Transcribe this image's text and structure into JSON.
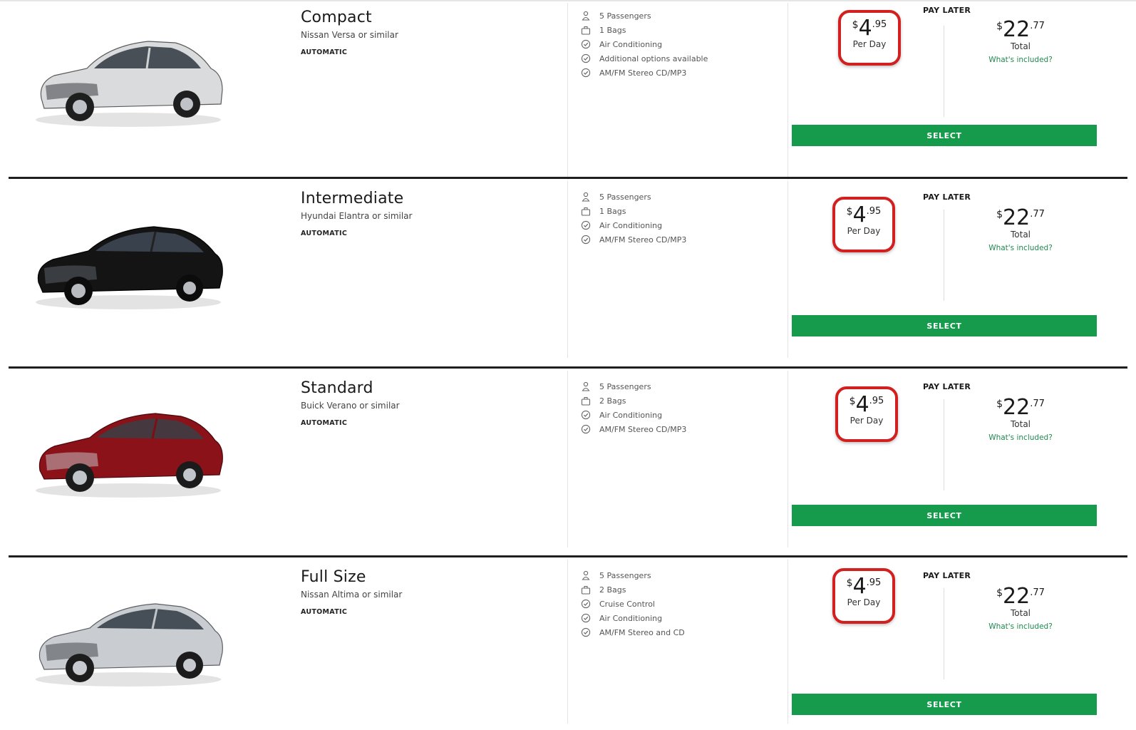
{
  "colors": {
    "accent_green": "#169a4c",
    "highlight_red": "#d21f1f",
    "link_green": "#1d8a4e"
  },
  "cars": [
    {
      "class_name": "Compact",
      "model": "Nissan Versa or similar",
      "transmission": "AUTOMATIC",
      "car_color": "#d9dbdd",
      "features": [
        {
          "icon": "person-icon",
          "label": "5 Passengers"
        },
        {
          "icon": "bag-icon",
          "label": "1 Bags"
        },
        {
          "icon": "check-circle-icon",
          "label": "Air Conditioning"
        },
        {
          "icon": "check-circle-icon",
          "label": "Additional options available"
        },
        {
          "icon": "check-circle-icon",
          "label": "AM/FM Stereo CD/MP3"
        }
      ],
      "per_day": {
        "currency": "$",
        "whole": "4",
        "cents": ".95",
        "label": "Per Day"
      },
      "pay_label": "PAY LATER",
      "total": {
        "currency": "$",
        "whole": "22",
        "cents": ".77",
        "label": "Total",
        "link": "What's included?"
      },
      "select_label": "SELECT"
    },
    {
      "class_name": "Intermediate",
      "model": "Hyundai Elantra or similar",
      "transmission": "AUTOMATIC",
      "car_color": "#141414",
      "features": [
        {
          "icon": "person-icon",
          "label": "5 Passengers"
        },
        {
          "icon": "bag-icon",
          "label": "1 Bags"
        },
        {
          "icon": "check-circle-icon",
          "label": "Air Conditioning"
        },
        {
          "icon": "check-circle-icon",
          "label": "AM/FM Stereo CD/MP3"
        }
      ],
      "per_day": {
        "currency": "$",
        "whole": "4",
        "cents": ".95",
        "label": "Per Day"
      },
      "pay_label": "PAY LATER",
      "total": {
        "currency": "$",
        "whole": "22",
        "cents": ".77",
        "label": "Total",
        "link": "What's included?"
      },
      "select_label": "SELECT"
    },
    {
      "class_name": "Standard",
      "model": "Buick Verano or similar",
      "transmission": "AUTOMATIC",
      "car_color": "#8b1219",
      "features": [
        {
          "icon": "person-icon",
          "label": "5 Passengers"
        },
        {
          "icon": "bag-icon",
          "label": "2 Bags"
        },
        {
          "icon": "check-circle-icon",
          "label": "Air Conditioning"
        },
        {
          "icon": "check-circle-icon",
          "label": "AM/FM Stereo CD/MP3"
        }
      ],
      "per_day": {
        "currency": "$",
        "whole": "4",
        "cents": ".95",
        "label": "Per Day"
      },
      "pay_label": "PAY LATER",
      "total": {
        "currency": "$",
        "whole": "22",
        "cents": ".77",
        "label": "Total",
        "link": "What's included?"
      },
      "select_label": "SELECT"
    },
    {
      "class_name": "Full Size",
      "model": "Nissan Altima or similar",
      "transmission": "AUTOMATIC",
      "car_color": "#c9ccd0",
      "features": [
        {
          "icon": "person-icon",
          "label": "5 Passengers"
        },
        {
          "icon": "bag-icon",
          "label": "2 Bags"
        },
        {
          "icon": "check-circle-icon",
          "label": "Cruise Control"
        },
        {
          "icon": "check-circle-icon",
          "label": "Air Conditioning"
        },
        {
          "icon": "check-circle-icon",
          "label": "AM/FM Stereo and CD"
        }
      ],
      "per_day": {
        "currency": "$",
        "whole": "4",
        "cents": ".95",
        "label": "Per Day"
      },
      "pay_label": "PAY LATER",
      "total": {
        "currency": "$",
        "whole": "22",
        "cents": ".77",
        "label": "Total",
        "link": "What's included?"
      },
      "select_label": "SELECT"
    }
  ]
}
